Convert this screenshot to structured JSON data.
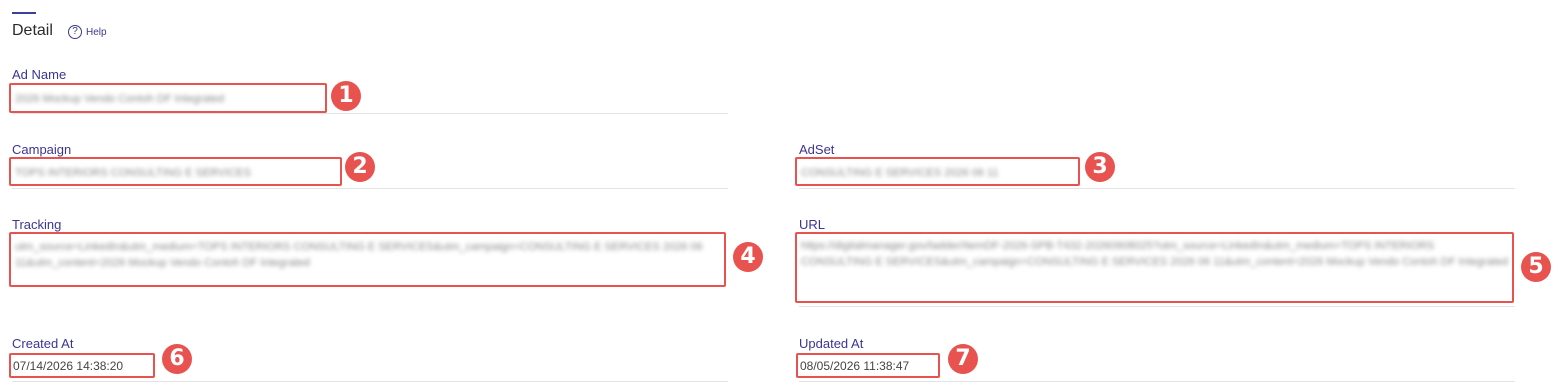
{
  "header": {
    "title": "Detail",
    "help_label": "Help",
    "help_icon": "?"
  },
  "fields": {
    "ad_name": {
      "label": "Ad Name",
      "value": "2026 Mockup Vendo Contoh DF Integrated"
    },
    "campaign": {
      "label": "Campaign",
      "value": "TOPS INTERIORS CONSULTING E SERVICES"
    },
    "adset": {
      "label": "AdSet",
      "value": "CONSULTING E SERVICES 2026 06 11"
    },
    "tracking": {
      "label": "Tracking",
      "value": "utm_source=LinkedIn&utm_medium=TOPS INTERIORS CONSULTING E SERVICES&utm_campaign=CONSULTING E SERVICES 2026 06 11&utm_content=2026 Mockup Vendo Contoh DF Integrated"
    },
    "url": {
      "label": "URL",
      "value": "https://digitalmanager.gov/ladder/ItemDF-2026-SPB-T432-20260908025?utm_source=LinkedIn&utm_medium=TOPS INTERIORS CONSULTING E SERVICES&utm_campaign=CONSULTING E SERVICES 2026 06 11&utm_content=2026 Mockup Vendo Contoh DF Integrated"
    },
    "created_at": {
      "label": "Created At",
      "value": "07/14/2026 14:38:20"
    },
    "updated_at": {
      "label": "Updated At",
      "value": "08/05/2026 11:38:47"
    }
  },
  "annotations": [
    "1",
    "2",
    "3",
    "4",
    "5",
    "6",
    "7"
  ],
  "colors": {
    "annotation": "#e8524f",
    "label": "#3b3593",
    "accent": "#3b3f9e"
  }
}
